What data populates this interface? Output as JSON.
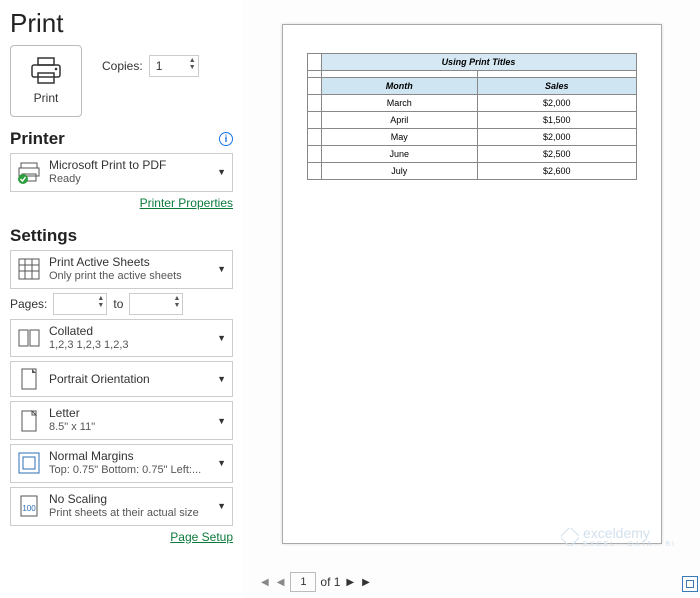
{
  "title": "Print",
  "printButton": "Print",
  "copies": {
    "label": "Copies:",
    "value": "1"
  },
  "printer": {
    "heading": "Printer",
    "name": "Microsoft Print to PDF",
    "status": "Ready",
    "propsLink": "Printer Properties"
  },
  "settings": {
    "heading": "Settings",
    "scope": {
      "main": "Print Active Sheets",
      "sub": "Only print the active sheets"
    },
    "pages": {
      "label": "Pages:",
      "to": "to"
    },
    "collate": {
      "main": "Collated",
      "sub": "1,2,3   1,2,3   1,2,3"
    },
    "orientation": {
      "main": "Portrait Orientation"
    },
    "paper": {
      "main": "Letter",
      "sub": "8.5\" x 11\""
    },
    "margins": {
      "main": "Normal Margins",
      "sub": "Top: 0.75\" Bottom: 0.75\" Left:..."
    },
    "scaling": {
      "main": "No Scaling",
      "sub": "Print sheets at their actual size"
    },
    "setupLink": "Page Setup"
  },
  "preview": {
    "tableTitle": "Using Print Titles",
    "cols": [
      "Month",
      "Sales"
    ],
    "rows": [
      [
        "March",
        "$2,000"
      ],
      [
        "April",
        "$1,500"
      ],
      [
        "May",
        "$2,000"
      ],
      [
        "June",
        "$2,500"
      ],
      [
        "July",
        "$2,600"
      ]
    ]
  },
  "nav": {
    "page": "1",
    "of": "of 1"
  },
  "watermark": {
    "main": "exceldemy",
    "sub": "EXCEL · DATA · BI"
  }
}
